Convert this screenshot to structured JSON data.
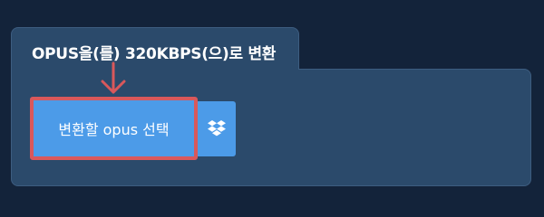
{
  "panel": {
    "title": "OPUS을(를) 320KBPS(으)로 변환"
  },
  "buttons": {
    "select_label": "변환할 opus 선택",
    "dropbox_icon": "dropbox-icon"
  },
  "colors": {
    "page_background": "#13233a",
    "panel_background": "#2b4a6b",
    "button_blue": "#4c9be8",
    "highlight_red": "#d9585b"
  }
}
